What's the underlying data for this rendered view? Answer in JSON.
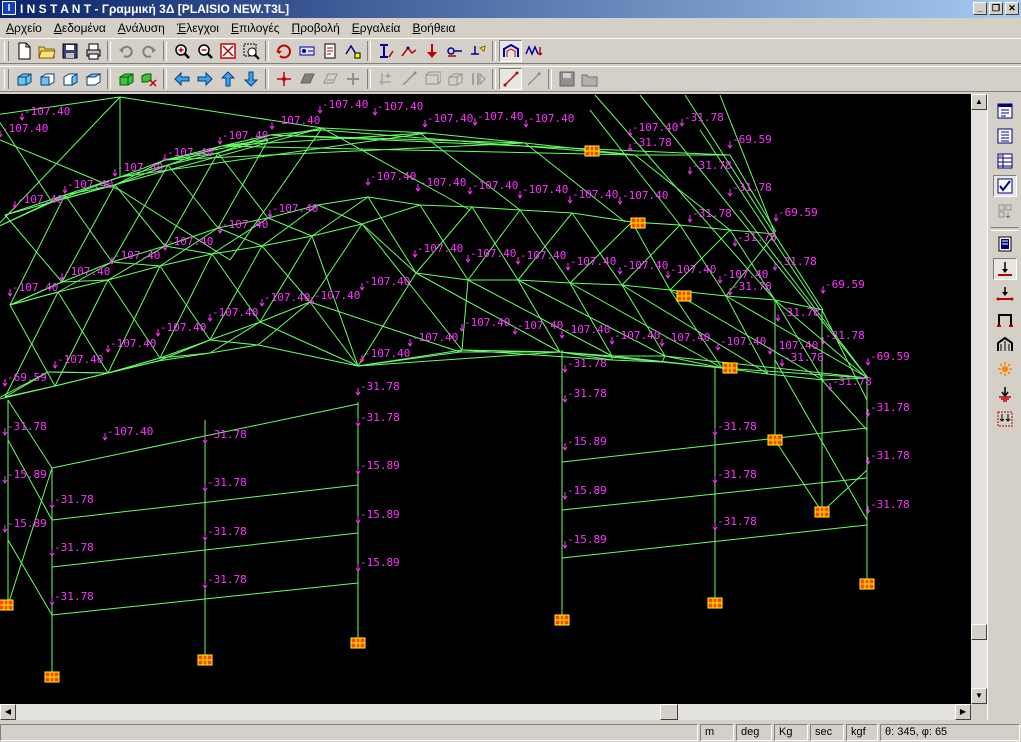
{
  "window": {
    "title": "I N S T A N T - Γραμμική 3Δ [PLAISIO NEW.T3L]",
    "icon_letter": "I",
    "minimize_label": "_",
    "restore_label": "❐",
    "close_label": "✕"
  },
  "menu": [
    "Αρχείο",
    "Δεδομένα",
    "Ανάλυση",
    "Έλεγχοι",
    "Επιλογές",
    "Προβολή",
    "Εργαλεία",
    "Βοήθεια"
  ],
  "toolbar1": [
    {
      "name": "new-file-icon"
    },
    {
      "name": "open-folder-icon"
    },
    {
      "name": "save-icon"
    },
    {
      "name": "print-icon"
    },
    {
      "sep": true
    },
    {
      "name": "undo-icon",
      "disabled": true
    },
    {
      "name": "redo-icon",
      "disabled": true
    },
    {
      "sep": true
    },
    {
      "name": "zoom-in-icon"
    },
    {
      "name": "zoom-out-icon"
    },
    {
      "name": "zoom-extents-icon"
    },
    {
      "name": "zoom-window-icon"
    },
    {
      "sep": true
    },
    {
      "name": "rotate-icon"
    },
    {
      "name": "node-numbers-icon"
    },
    {
      "name": "load-list-icon"
    },
    {
      "name": "dimensions-icon"
    },
    {
      "sep": true
    },
    {
      "name": "member-properties-icon"
    },
    {
      "name": "section-icon"
    },
    {
      "name": "supports-icon"
    },
    {
      "name": "releases-icon"
    },
    {
      "name": "materials-icon"
    },
    {
      "sep": true
    },
    {
      "name": "frame-view-icon",
      "active": true
    },
    {
      "name": "diagram-icon"
    }
  ],
  "toolbar2": [
    {
      "name": "view-3d-icon"
    },
    {
      "name": "view-front-icon"
    },
    {
      "name": "view-side-icon"
    },
    {
      "name": "view-top-icon"
    },
    {
      "sep": true
    },
    {
      "name": "solid-render-icon"
    },
    {
      "name": "select-objects-icon"
    },
    {
      "sep": true
    },
    {
      "name": "arrow-left-icon"
    },
    {
      "name": "arrow-right-icon"
    },
    {
      "name": "arrow-up-icon"
    },
    {
      "name": "arrow-down-icon"
    },
    {
      "sep": true
    },
    {
      "name": "add-node-icon"
    },
    {
      "name": "add-plate-icon",
      "disabled": true
    },
    {
      "name": "copy-plate-icon",
      "disabled": true
    },
    {
      "name": "add-cross-icon",
      "disabled": true
    },
    {
      "sep": true
    },
    {
      "name": "offset-node-icon",
      "disabled": true
    },
    {
      "name": "draw-member-icon",
      "disabled": true
    },
    {
      "name": "rectangle-icon",
      "disabled": true
    },
    {
      "name": "box-icon",
      "disabled": true
    },
    {
      "name": "mirror-icon",
      "disabled": true
    },
    {
      "sep": true
    },
    {
      "name": "member-line-icon",
      "active": true
    },
    {
      "name": "line-tool-icon",
      "disabled": true
    },
    {
      "sep": true
    },
    {
      "name": "save-disk-icon",
      "disabled": true
    },
    {
      "name": "open-disk-icon",
      "disabled": true
    }
  ],
  "right_panel": [
    {
      "name": "window-icon"
    },
    {
      "name": "list-icon"
    },
    {
      "name": "table-icon"
    },
    {
      "name": "checkbox-icon",
      "active": true
    },
    {
      "name": "grid-load-icon",
      "disabled": true
    },
    {
      "sep": true
    },
    {
      "name": "report-icon"
    },
    {
      "name": "point-load-icon",
      "active": true
    },
    {
      "name": "member-load-icon"
    },
    {
      "name": "frame-load-icon"
    },
    {
      "name": "distributed-load-icon"
    },
    {
      "name": "temperature-load-icon"
    },
    {
      "name": "settlement-icon"
    },
    {
      "name": "combined-load-icon"
    }
  ],
  "status": {
    "length_unit": "m",
    "angle_unit": "deg",
    "mass_unit": "Kg",
    "time_unit": "sec",
    "force_unit": "kgf",
    "view_angles": "θ: 345, φ: 65"
  },
  "load_labels": [
    "-107.40",
    "-107.40",
    "-107.40",
    "-107.40",
    "-107.40",
    "-107.40",
    "-107.40",
    "-107.40",
    "-107.40",
    "-107.40",
    "-107.40",
    "-107.40",
    "-107.40",
    "-107.40",
    "-107.40",
    "-107.40",
    "-107.40",
    "-107.40",
    "-107.40",
    "-107.40",
    "-107.40",
    "-107.40",
    "-107.40",
    "-107.40",
    "-107.40",
    "-107.40",
    "-107.40",
    "-107.40",
    "-107.40",
    "-107.40",
    "-107.40",
    "-107.40",
    "-107.40",
    "-107.40",
    "-107.40",
    "-107.40",
    "-107.40",
    "-107.40",
    "-107.40",
    "-107.40",
    "-107.40",
    "-107.40",
    "-107.40",
    "-107.40",
    "-107.40",
    "-107.40",
    "-107.40",
    "-107.40",
    "-107.40",
    "-107.40",
    "-69.59",
    "-69.59",
    "-69.59",
    "-69.59",
    "-69.59",
    "-31.78",
    "-31.78",
    "-31.78",
    "-31.78",
    "-31.78",
    "-31.78",
    "-31.78",
    "-31.78",
    "-31.78",
    "-31.78",
    "-31.78",
    "-31.78",
    "-31.78",
    "-31.78",
    "-31.78",
    "-31.78",
    "-31.78",
    "-31.78",
    "-31.78",
    "-31.78",
    "-31.78",
    "-31.78",
    "-31.78",
    "-31.78",
    "-31.78",
    "-31.78",
    "-31.78",
    "-31.78",
    "-31.78",
    "-31.78",
    "-15.89",
    "-15.89",
    "-15.89",
    "-15.89",
    "-15.89",
    "-15.89",
    "-15.89",
    "-15.89"
  ],
  "colors": {
    "background": "#000000",
    "member": "#66ff66",
    "load": "#ff33ff",
    "support_fill": "#ff4400",
    "support_grid": "#ffff00",
    "node": "#ffff00",
    "titlebar_start": "#0a246a",
    "titlebar_end": "#a6caf0"
  }
}
